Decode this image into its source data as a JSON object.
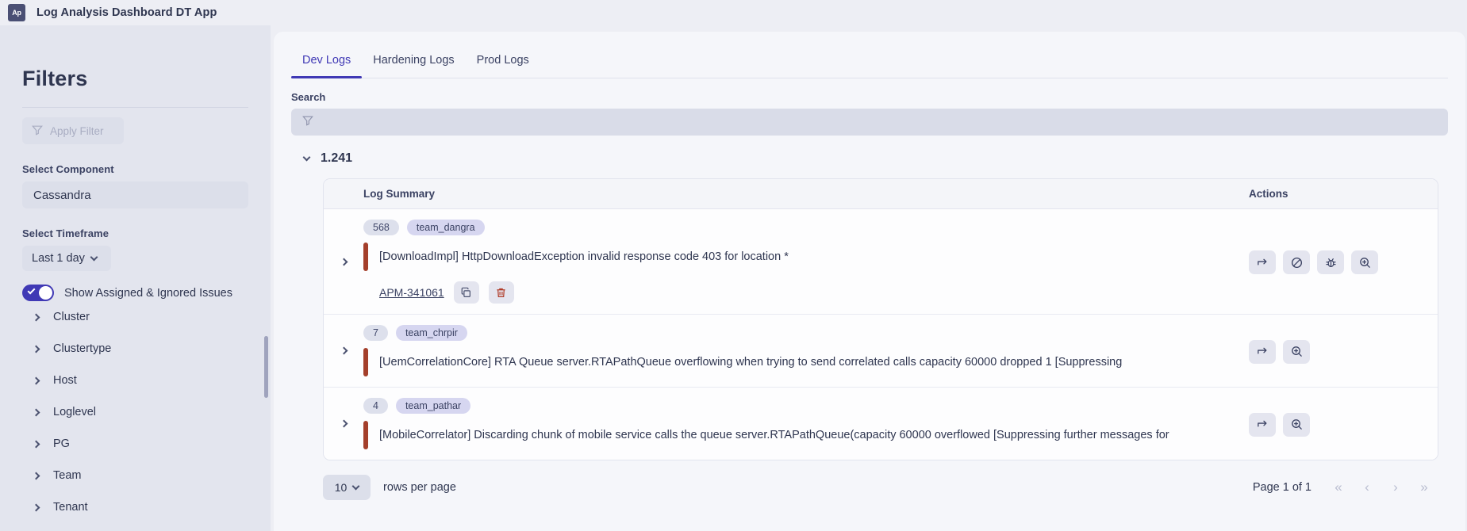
{
  "titlebar": {
    "logo_text": "Ap",
    "logo_icon": "app-logo-icon",
    "title": "Log Analysis Dashboard DT App"
  },
  "sidebar": {
    "heading": "Filters",
    "apply_filter": {
      "label": "Apply Filter",
      "icon": "filter-icon"
    },
    "component": {
      "label": "Select Component",
      "value": "Cassandra"
    },
    "timeframe": {
      "label": "Select Timeframe",
      "value": "Last 1 day",
      "icon": "chevron-down-icon"
    },
    "toggle": {
      "label": "Show Assigned & Ignored Issues",
      "checked": true
    },
    "facets": [
      {
        "label": "Cluster"
      },
      {
        "label": "Clustertype"
      },
      {
        "label": "Host"
      },
      {
        "label": "Loglevel"
      },
      {
        "label": "PG"
      },
      {
        "label": "Team"
      },
      {
        "label": "Tenant"
      }
    ]
  },
  "main": {
    "tabs": [
      {
        "label": "Dev Logs",
        "active": true
      },
      {
        "label": "Hardening Logs",
        "active": false
      },
      {
        "label": "Prod Logs",
        "active": false
      }
    ],
    "search": {
      "label": "Search",
      "value": "",
      "placeholder": "",
      "icon": "filter-icon"
    },
    "group": {
      "version": "1.241",
      "expander_icon": "chevron-down-icon"
    },
    "table": {
      "columns": [
        "Log Summary",
        "Actions"
      ],
      "rows": [
        {
          "count": "568",
          "team": "team_dangra",
          "message": "[DownloadImpl] HttpDownloadException invalid response code 403 for location *",
          "ticket": "APM-341061",
          "ticket_actions": [
            {
              "icon": "copy-icon",
              "name": "copy-ticket-button"
            },
            {
              "icon": "trash-icon",
              "name": "delete-ticket-button"
            }
          ],
          "actions": [
            {
              "icon": "assign-arrow-icon",
              "name": "assign-button"
            },
            {
              "icon": "eye-off-icon",
              "name": "ignore-button"
            },
            {
              "icon": "bug-icon",
              "name": "create-bug-button"
            },
            {
              "icon": "magnify-plus-icon",
              "name": "inspect-button"
            }
          ]
        },
        {
          "count": "7",
          "team": "team_chrpir",
          "message": "[UemCorrelationCore] RTA Queue server.RTAPathQueue overflowing when trying to send correlated calls capacity 60000 dropped 1 [Suppressing",
          "ticket": null,
          "ticket_actions": [],
          "actions": [
            {
              "icon": "assign-arrow-icon",
              "name": "assign-button"
            },
            {
              "icon": "magnify-plus-icon",
              "name": "inspect-button"
            }
          ]
        },
        {
          "count": "4",
          "team": "team_pathar",
          "message": "[MobileCorrelator] Discarding chunk of mobile service calls the queue server.RTAPathQueue(capacity 60000 overflowed [Suppressing further messages for",
          "ticket": null,
          "ticket_actions": [],
          "actions": [
            {
              "icon": "assign-arrow-icon",
              "name": "assign-button"
            },
            {
              "icon": "magnify-plus-icon",
              "name": "inspect-button"
            }
          ]
        }
      ]
    },
    "footer": {
      "rows_per_page_value": "10",
      "rows_per_page_label": "rows per page",
      "page_text": "Page 1 of 1",
      "pager_buttons": [
        {
          "icon": "first-page-icon",
          "glyph": "«"
        },
        {
          "icon": "prev-page-icon",
          "glyph": "‹"
        },
        {
          "icon": "next-page-icon",
          "glyph": "›"
        },
        {
          "icon": "last-page-icon",
          "glyph": "»"
        }
      ]
    }
  },
  "colors": {
    "accent": "#4039b5",
    "severity_bar": "#a43f2b",
    "panel_bg": "#f5f6fa",
    "sidebar_bg": "#e3e5ee",
    "window_bg": "#edeef4"
  }
}
